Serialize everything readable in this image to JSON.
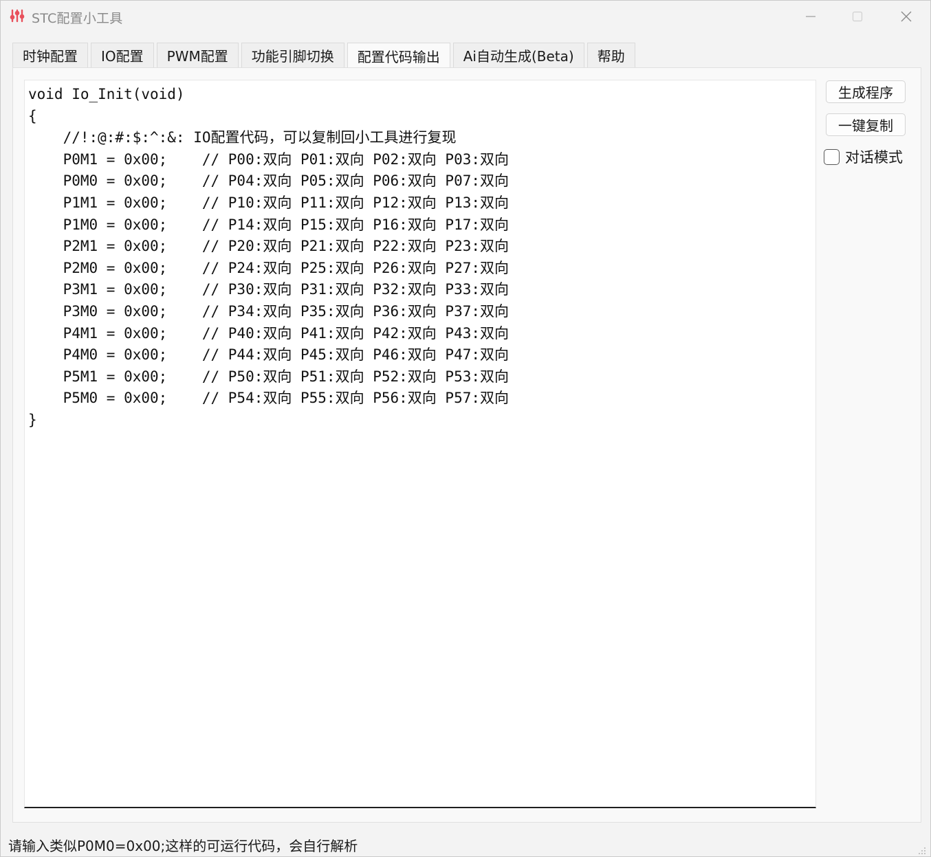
{
  "window": {
    "title": "STC配置小工具",
    "app_icon": "equalizer-icon",
    "controls": [
      "minimize-icon",
      "maximize-icon",
      "close-icon"
    ]
  },
  "tabs": [
    {
      "label": "时钟配置",
      "active": false
    },
    {
      "label": "IO配置",
      "active": false
    },
    {
      "label": "PWM配置",
      "active": false
    },
    {
      "label": "功能引脚切换",
      "active": false
    },
    {
      "label": "配置代码输出",
      "active": true
    },
    {
      "label": "Ai自动生成(Beta)",
      "active": false
    },
    {
      "label": "帮助",
      "active": false
    }
  ],
  "editor": {
    "lines": [
      "void Io_Init(void)",
      "{",
      "    //!:@:#:$:^:&: IO配置代码，可以复制回小工具进行复现",
      "    P0M1 = 0x00;    // P00:双向 P01:双向 P02:双向 P03:双向",
      "    P0M0 = 0x00;    // P04:双向 P05:双向 P06:双向 P07:双向",
      "    P1M1 = 0x00;    // P10:双向 P11:双向 P12:双向 P13:双向",
      "    P1M0 = 0x00;    // P14:双向 P15:双向 P16:双向 P17:双向",
      "    P2M1 = 0x00;    // P20:双向 P21:双向 P22:双向 P23:双向",
      "    P2M0 = 0x00;    // P24:双向 P25:双向 P26:双向 P27:双向",
      "    P3M1 = 0x00;    // P30:双向 P31:双向 P32:双向 P33:双向",
      "    P3M0 = 0x00;    // P34:双向 P35:双向 P36:双向 P37:双向",
      "    P4M1 = 0x00;    // P40:双向 P41:双向 P42:双向 P43:双向",
      "    P4M0 = 0x00;    // P44:双向 P45:双向 P46:双向 P47:双向",
      "    P5M1 = 0x00;    // P50:双向 P51:双向 P52:双向 P53:双向",
      "    P5M0 = 0x00;    // P54:双向 P55:双向 P56:双向 P57:双向",
      "}"
    ]
  },
  "side": {
    "generate_label": "生成程序",
    "copy_label": "一键复制",
    "dialog_mode_label": "对话模式",
    "dialog_mode_checked": false
  },
  "status": {
    "text": "请输入类似P0M0=0x00;这样的可运行代码，会自行解析"
  },
  "colors": {
    "window_bg": "#f3f3f3",
    "editor_bg": "#ffffff",
    "title_text": "#8a8a8a",
    "icon_accent": "#e8505b"
  }
}
